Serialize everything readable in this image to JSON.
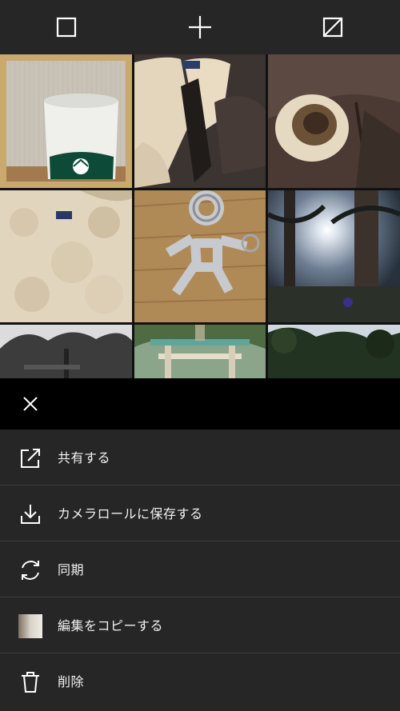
{
  "toolbar": {
    "buttons": [
      {
        "name": "select-frame-icon"
      },
      {
        "name": "plus-icon"
      },
      {
        "name": "compare-icon"
      }
    ]
  },
  "grid": {
    "photos": [
      {
        "subject": "Starbucks mug"
      },
      {
        "subject": "shearling leather jacket"
      },
      {
        "subject": "jacket sleeve cuff"
      },
      {
        "subject": "fleece lining with label"
      },
      {
        "subject": "metal figure keychain"
      },
      {
        "subject": "tall trees with sun"
      },
      {
        "subject": "trees black and white"
      },
      {
        "subject": "torii gate"
      },
      {
        "subject": "forest canopy"
      }
    ]
  },
  "sheet": {
    "close_icon": "close-icon",
    "items": [
      {
        "label": "共有する",
        "icon": "share-icon"
      },
      {
        "label": "カメラロールに保存する",
        "icon": "download-icon"
      },
      {
        "label": "同期",
        "icon": "sync-icon"
      },
      {
        "label": "編集をコピーする",
        "icon": "edit-thumbnail-icon"
      },
      {
        "label": "削除",
        "icon": "trash-icon"
      }
    ]
  },
  "colors": {
    "toolbar_bg": "#262626",
    "sheet_header_bg": "#000000",
    "menu_bg": "#262626",
    "divider": "#3d3d3d",
    "text": "#f2f2f2",
    "selected_outline": "#c9a96e"
  }
}
